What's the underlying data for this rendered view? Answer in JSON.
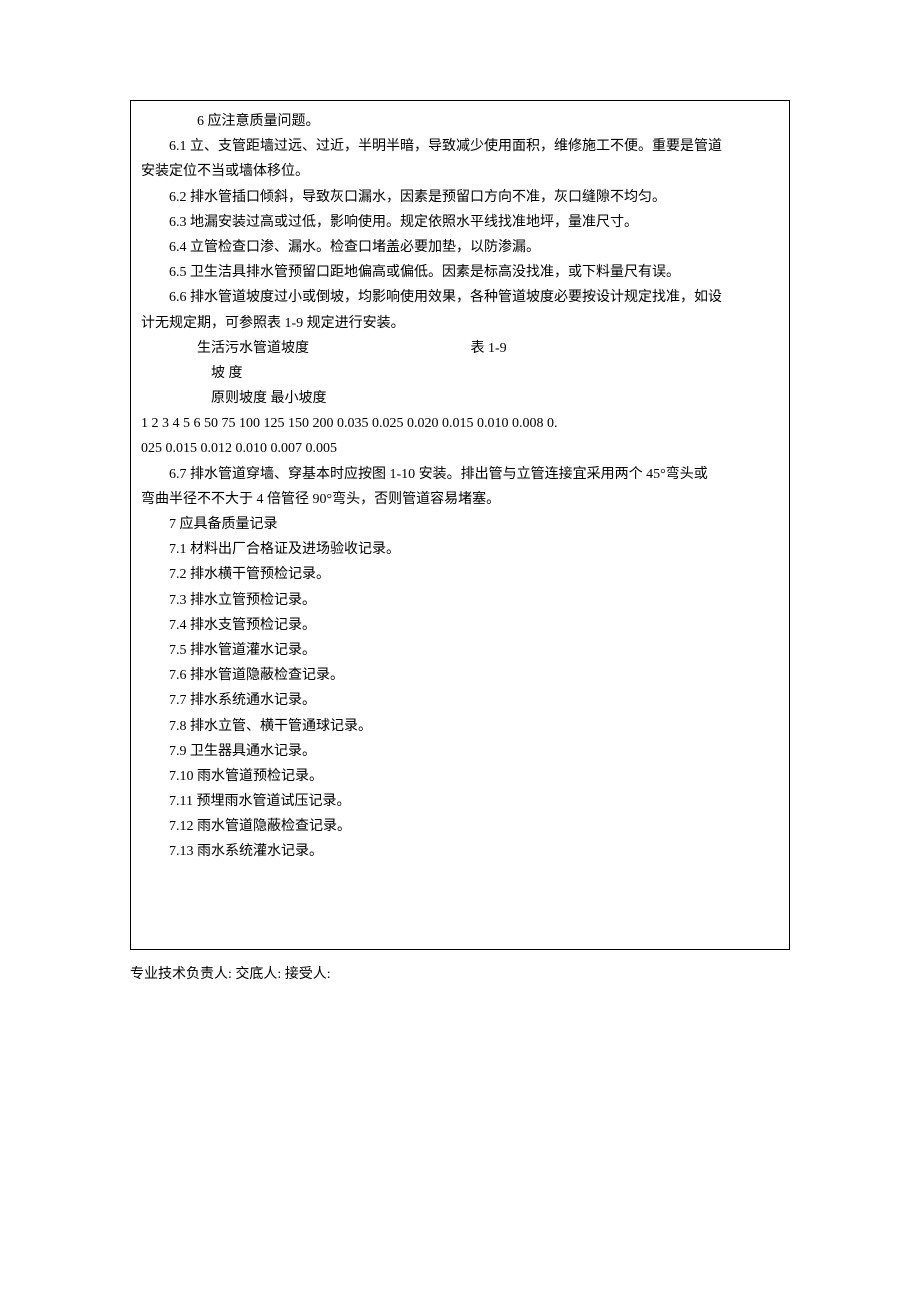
{
  "content": {
    "p1": "6   应注意质量问题。",
    "p2": "6.1   立、支管距墙过远、过近，半明半暗，导致减少使用面积，维修施工不便。重要是管道安装定位不当或墙体移位。",
    "p2_first": "6.1   立、支管距墙过远、过近，半明半暗，导致减少使用面积，维修施工不便。重要是管道",
    "p2_second": "安装定位不当或墙体移位。",
    "p3": "6.2   排水管插口倾斜，导致灰口漏水，因素是预留口方向不准，灰口缝隙不均匀。",
    "p4": "6.3   地漏安装过高或过低，影响使用。规定依照水平线找准地坪，量准尺寸。",
    "p5": "6.4   立管检查口渗、漏水。检查口堵盖必要加垫，以防渗漏。",
    "p6": "6.5   卫生洁具排水管预留口距地偏高或偏低。因素是标高没找准，或下料量尺有误。",
    "p7_first": "6.6   排水管道坡度过小或倒坡，均影响使用效果，各种管道坡度必要按设计规定找准，如设",
    "p7_second": "计无规定期，可参照表 1-9 规定进行安装。",
    "p8": "生活污水管道坡度",
    "p8_table": "表 1-9",
    "p9": "坡       度",
    "p10": "原则坡度   最小坡度",
    "p11": "1 2 3 4 5 6  50 75 100 125 150 200 0.035  0.025  0.020  0.015  0.010  0.008      0.",
    "p12": "025 0.015 0.012 0.010 0.007 0.005",
    "p13_first": "6.7   排水管道穿墙、穿基本时应按图 1-10 安装。排出管与立管连接宜采用两个 45°弯头或",
    "p13_second": "弯曲半径不不大于 4 倍管径 90°弯头，否则管道容易堵塞。",
    "p14": "7   应具备质量记录",
    "p15": "7.1   材料出厂合格证及进场验收记录。",
    "p16": "7.2   排水横干管预检记录。",
    "p17": "7.3   排水立管预检记录。",
    "p18": "7.4   排水支管预检记录。",
    "p19": "7.5   排水管道灌水记录。",
    "p20": "7.6   排水管道隐蔽检查记录。",
    "p21": "7.7   排水系统通水记录。",
    "p22": "7.8   排水立管、横干管通球记录。",
    "p23": "7.9   卫生器具通水记录。",
    "p24": "7.10   雨水管道预检记录。",
    "p25": "7.11   预埋雨水管道试压记录。",
    "p26": "7.12   雨水管道隐蔽检查记录。",
    "p27": "7.13   雨水系统灌水记录。"
  },
  "signature": {
    "line": "专业技术负责人:         交底人:         接受人:"
  }
}
